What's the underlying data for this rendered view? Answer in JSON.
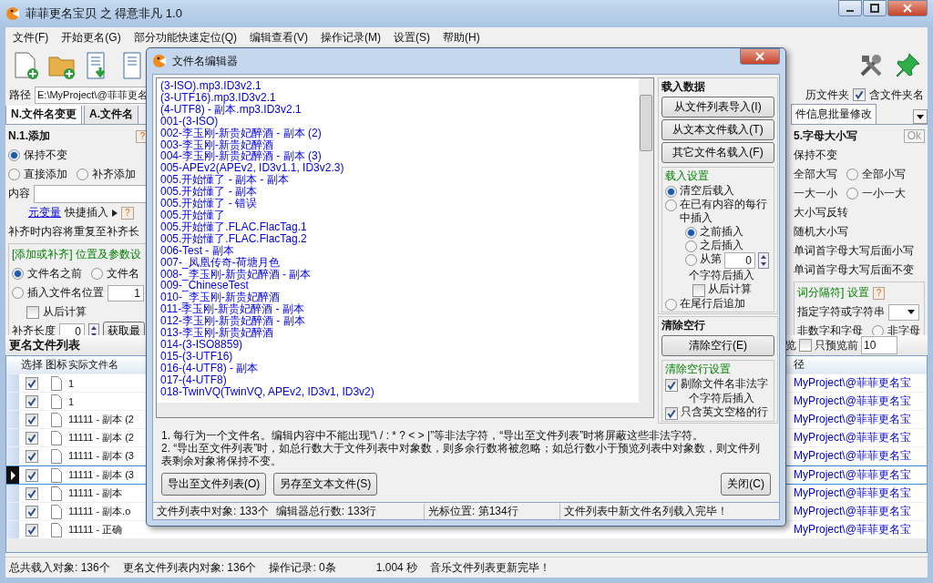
{
  "window": {
    "title": "菲菲更名宝贝 之 得意非凡 1.0"
  },
  "menu": [
    "文件(F)",
    "开始更名(G)",
    "部分功能快速定位(Q)",
    "编辑查看(V)",
    "操作记录(M)",
    "设置(S)",
    "帮助(H)"
  ],
  "path": {
    "label": "路径",
    "value": "E:\\MyProject\\@菲菲更名",
    "folder_option": "历文件夹",
    "include_folder": {
      "label": "含文件夹名",
      "checked": true
    }
  },
  "left_panel": {
    "tabs": [
      {
        "label": "N.文件名变更",
        "selected": true
      },
      {
        "label": "A.文件名",
        "selected": false
      }
    ],
    "group_title": "N.1.添加",
    "help": "?",
    "mode_options": [
      {
        "label": "保持不变",
        "selected": true
      },
      {
        "label": "直接添加",
        "selected": false
      },
      {
        "label": "补齐添加",
        "selected": false
      }
    ],
    "content_label": "内容",
    "variable_link": "元变量",
    "quick_insert": "快捷插入",
    "quick_help": "?",
    "note": "补齐时内容将重复至补齐长",
    "position_title": "[添加或补齐] 位置及参数设",
    "position_options": [
      {
        "label": "文件名之前",
        "selected": true
      },
      {
        "label": "文件名",
        "selected": false
      }
    ],
    "insert_position": {
      "label": "插入文件名位置",
      "selected": false,
      "value": "1"
    },
    "from_end": {
      "label": "从后计算",
      "checked": false
    },
    "pad_length": {
      "label": "补齐长度",
      "value": "0"
    },
    "get_button": "获取最"
  },
  "right_panel": {
    "tab": "件信息批量修改",
    "group_title": "5.字母大小写",
    "ok_button": "Ok",
    "rows": [
      {
        "options": [
          {
            "kind": "label",
            "label": "保持不变"
          }
        ]
      },
      {
        "options": [
          {
            "kind": "label",
            "label": "全部大写"
          },
          {
            "kind": "radio",
            "label": "全部小写",
            "selected": false
          }
        ]
      },
      {
        "options": [
          {
            "kind": "label",
            "label": "一大一小"
          },
          {
            "kind": "radio",
            "label": "一小一大",
            "selected": false
          }
        ]
      },
      {
        "options": [
          {
            "kind": "label",
            "label": "大小写反转"
          }
        ]
      },
      {
        "options": [
          {
            "kind": "label",
            "label": "随机大小写"
          }
        ]
      },
      {
        "options": [
          {
            "kind": "label",
            "label": "单词首字母大写后面小写"
          }
        ]
      },
      {
        "options": [
          {
            "kind": "label",
            "label": "单词首字母大写后面不变"
          }
        ]
      }
    ],
    "separator_title": "词分隔符] 设置",
    "separator_help": "?",
    "custom_label": "指定字符或字符串",
    "separator_rows": [
      {
        "kind": "label",
        "label": "非数字和字母"
      },
      {
        "kind": "radio",
        "label": "非字母",
        "selected": false
      }
    ]
  },
  "file_list": {
    "title": "更名文件列表",
    "preview_label": "览",
    "preview_first": {
      "label": "只预览前",
      "checked": false,
      "value": "10"
    },
    "columns": [
      "选择",
      "图标",
      "实际文件名",
      "径"
    ],
    "rows": [
      {
        "checked": true,
        "name": "1",
        "path": "MyProject\\@菲菲更名宝",
        "current": false
      },
      {
        "checked": true,
        "name": "1",
        "path": "MyProject\\@菲菲更名宝",
        "current": false
      },
      {
        "checked": true,
        "name": "11111 - 副本 (2",
        "path": "MyProject\\@菲菲更名宝",
        "current": false
      },
      {
        "checked": true,
        "name": "11111 - 副本 (2",
        "path": "MyProject\\@菲菲更名宝",
        "current": false
      },
      {
        "checked": true,
        "name": "11111 - 副本 (3",
        "path": "MyProject\\@菲菲更名宝",
        "current": false
      },
      {
        "checked": true,
        "name": "11111 - 副本 (3",
        "path": "MyProject\\@菲菲更名宝",
        "current": true
      },
      {
        "checked": true,
        "name": "11111 - 副本",
        "path": "MyProject\\@菲菲更名宝",
        "current": false
      },
      {
        "checked": true,
        "name": "11111 - 副本.o",
        "path": "MyProject\\@菲菲更名宝",
        "current": false
      },
      {
        "checked": true,
        "name": "11111 - 正确",
        "path": "MyProject\\@菲菲更名宝",
        "current": false
      }
    ]
  },
  "status_bar": [
    "总共载入对象: 136个",
    "更名文件列表内对象: 136个",
    "操作记录: 0条",
    "1.004 秒",
    "音乐文件列表更新完毕！"
  ],
  "dialog": {
    "title": "文件名编辑器",
    "lines": [
      "(3-ISO).mp3.ID3v2.1",
      "(3-UTF16).mp3.ID3v2.1",
      "(4-UTF8) - 副本.mp3.ID3v2.1",
      "001-(3-ISO)",
      "002-李玉刚-新贵妃醉酒 - 副本 (2)",
      "003-李玉刚-新贵妃醉酒",
      "004-李玉刚-新贵妃醉酒 - 副本 (3)",
      "005-APEv2(APEv2, ID3v1.1, ID3v2.3)",
      "005.开始懂了 - 副本 - 副本",
      "005.开始懂了 - 副本",
      "005.开始懂了 - 错误",
      "005.开始懂了",
      "005.开始懂了.FLAC.FlacTag.1",
      "005.开始懂了.FLAC.FlacTag.2",
      "006-Test - 副本",
      "007-_凤凰传奇-荷塘月色",
      "008-_李玉刚-新贵妃醉酒 - 副本",
      "009-_ChineseTest",
      "010-_李玉刚-新贵妃醉酒",
      "011-李玉刚-新贵妃醉酒 - 副本",
      "012-李玉刚-新贵妃醉酒 - 副本",
      "013-李玉刚-新贵妃醉酒",
      "014-(3-ISO8859)",
      "015-(3-UTF16)",
      "016-(4-UTF8) - 副本",
      "017-(4-UTF8)",
      "018-TwinVQ(TwinVQ, APEv2, ID3v1, ID3v2)"
    ],
    "load_title": "载入数据",
    "load_buttons": [
      "从文件列表导入(I)",
      "从文本文件载入(T)",
      "其它文件名载入(F)"
    ],
    "load_settings_title": "载入设置",
    "load_modes": [
      {
        "label": "清空后载入",
        "selected": true
      },
      {
        "label": "在已有内容的每行中插入",
        "selected": false
      }
    ],
    "insert_modes": [
      {
        "label": "之前插入",
        "selected": true
      },
      {
        "label": "之后插入",
        "selected": false
      },
      {
        "label": "从第",
        "selected": false,
        "value": "0"
      }
    ],
    "insert_suffix": "个字符后插入",
    "insert_from_end": {
      "label": "从后计算",
      "checked": false
    },
    "append_mode": {
      "label": "在尾行后追加",
      "selected": false
    },
    "clear_title": "清除空行",
    "clear_button": "清除空行(E)",
    "clear_settings_title": "清除空行设置",
    "clear_options": [
      {
        "label": "剔除文件名非法字",
        "checked": true
      },
      {
        "label": "只含英文空格的行",
        "checked": true
      }
    ],
    "clear_overlap_text": "个字符后插入",
    "notes": [
      "1. 每行为一个文件名。编辑内容中不能出现“\\ / : * ? < > |”等非法字符，“导出至文件列表”时将屏蔽这些非法字符。",
      "2. “导出至文件列表”时，如总行数大于文件列表中对象数，则多余行数将被忽略；如总行数小于预览列表中对象数，则文件列表剩余对象将保持不变。"
    ],
    "buttons": [
      "导出至文件列表(O)",
      "另存至文本文件(S)"
    ],
    "close_button": "关闭(C)",
    "status_bar": [
      "文件列表中对象: 133个",
      "编辑器总行数: 133行",
      "光标位置: 第134行",
      "文件列表中新文件名列载入完毕！"
    ]
  }
}
